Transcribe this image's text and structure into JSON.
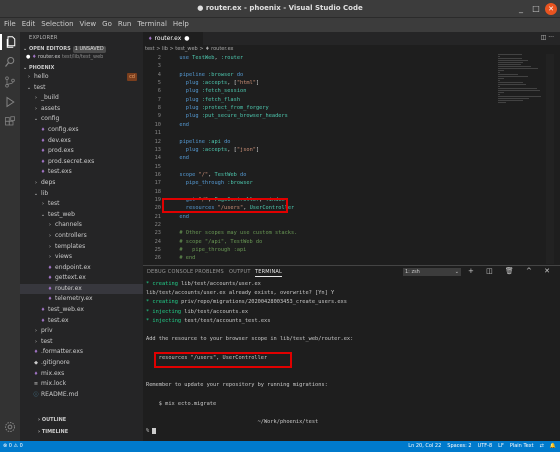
{
  "window": {
    "title": "● router.ex - phoenix - Visual Studio Code",
    "controls": {
      "minimize": "_",
      "maximize": "□",
      "close": "✕"
    }
  },
  "menu": [
    "File",
    "Edit",
    "Selection",
    "View",
    "Go",
    "Run",
    "Terminal",
    "Help"
  ],
  "sidebar": {
    "header": "EXPLORER",
    "open_editors": {
      "label": "OPEN EDITORS",
      "badge": "1 UNSAVED",
      "files": [
        {
          "dot": "●",
          "name": "router.ex",
          "path": "test/lib/test_web"
        }
      ]
    },
    "project": "PHOENIX",
    "tree": [
      {
        "indent": 0,
        "icon": "chevron-right",
        "label": "hello",
        "tag": "cd"
      },
      {
        "indent": 0,
        "icon": "chevron-down",
        "label": "test"
      },
      {
        "indent": 1,
        "icon": "chevron-right",
        "label": "_build"
      },
      {
        "indent": 1,
        "icon": "chevron-right",
        "label": "assets"
      },
      {
        "indent": 1,
        "icon": "chevron-down",
        "label": "config"
      },
      {
        "indent": 2,
        "icon": "elixir-file",
        "label": "config.exs"
      },
      {
        "indent": 2,
        "icon": "elixir-file",
        "label": "dev.exs"
      },
      {
        "indent": 2,
        "icon": "elixir-file",
        "label": "prod.exs"
      },
      {
        "indent": 2,
        "icon": "elixir-file",
        "label": "prod.secret.exs"
      },
      {
        "indent": 2,
        "icon": "elixir-file",
        "label": "test.exs"
      },
      {
        "indent": 1,
        "icon": "chevron-right",
        "label": "deps"
      },
      {
        "indent": 1,
        "icon": "chevron-down",
        "label": "lib"
      },
      {
        "indent": 2,
        "icon": "chevron-right",
        "label": "test"
      },
      {
        "indent": 2,
        "icon": "chevron-down",
        "label": "test_web"
      },
      {
        "indent": 3,
        "icon": "chevron-right",
        "label": "channels"
      },
      {
        "indent": 3,
        "icon": "chevron-right",
        "label": "controllers"
      },
      {
        "indent": 3,
        "icon": "chevron-right",
        "label": "templates"
      },
      {
        "indent": 3,
        "icon": "chevron-right",
        "label": "views"
      },
      {
        "indent": 3,
        "icon": "elixir-file",
        "label": "endpoint.ex"
      },
      {
        "indent": 3,
        "icon": "elixir-file",
        "label": "gettext.ex"
      },
      {
        "indent": 3,
        "icon": "elixir-file",
        "label": "router.ex",
        "selected": true
      },
      {
        "indent": 3,
        "icon": "elixir-file",
        "label": "telemetry.ex"
      },
      {
        "indent": 2,
        "icon": "elixir-file",
        "label": "test_web.ex"
      },
      {
        "indent": 2,
        "icon": "elixir-file",
        "label": "test.ex"
      },
      {
        "indent": 1,
        "icon": "chevron-right",
        "label": "priv"
      },
      {
        "indent": 1,
        "icon": "chevron-right",
        "label": "test"
      },
      {
        "indent": 1,
        "icon": "elixir-file",
        "label": ".formatter.exs"
      },
      {
        "indent": 1,
        "icon": "git-file",
        "label": ".gitignore"
      },
      {
        "indent": 1,
        "icon": "elixir-file",
        "label": "mix.exs"
      },
      {
        "indent": 1,
        "icon": "lock-file",
        "label": "mix.lock"
      },
      {
        "indent": 1,
        "icon": "info-file",
        "label": "README.md"
      }
    ],
    "outline": "OUTLINE",
    "timeline": "TIMELINE"
  },
  "editor": {
    "tab": {
      "label": "router.ex",
      "dirty": "●"
    },
    "tab_actions": "◫ ···",
    "breadcrumb": "test > lib > test_web > ♦ router.ex",
    "lines": [
      {
        "n": "2",
        "code": "  use TestWeb, :router"
      },
      {
        "n": "3",
        "code": ""
      },
      {
        "n": "4",
        "code": "  pipeline :browser do"
      },
      {
        "n": "5",
        "code": "    plug :accepts, [\"html\"]"
      },
      {
        "n": "6",
        "code": "    plug :fetch_session"
      },
      {
        "n": "7",
        "code": "    plug :fetch_flash"
      },
      {
        "n": "8",
        "code": "    plug :protect_from_forgery"
      },
      {
        "n": "9",
        "code": "    plug :put_secure_browser_headers"
      },
      {
        "n": "10",
        "code": "  end"
      },
      {
        "n": "11",
        "code": ""
      },
      {
        "n": "12",
        "code": "  pipeline :api do"
      },
      {
        "n": "13",
        "code": "    plug :accepts, [\"json\"]"
      },
      {
        "n": "14",
        "code": "  end"
      },
      {
        "n": "15",
        "code": ""
      },
      {
        "n": "16",
        "code": "  scope \"/\", TestWeb do"
      },
      {
        "n": "17",
        "code": "    pipe_through :browser"
      },
      {
        "n": "18",
        "code": ""
      },
      {
        "n": "19",
        "code": "    get \"/\", PageController, :index"
      },
      {
        "n": "20",
        "code": "    resources \"/users\", UserController"
      },
      {
        "n": "21",
        "code": "  end"
      },
      {
        "n": "22",
        "code": ""
      },
      {
        "n": "23",
        "code": "  # Other scopes may use custom stacks."
      },
      {
        "n": "24",
        "code": "  # scope \"/api\", TestWeb do"
      },
      {
        "n": "25",
        "code": "  #   pipe_through :api"
      },
      {
        "n": "26",
        "code": "  # end"
      }
    ]
  },
  "panel": {
    "tabs": [
      "DEBUG CONSOLE",
      "PROBLEMS",
      "OUTPUT",
      "TERMINAL"
    ],
    "active_tab": "TERMINAL",
    "terminal_select": "1: zsh",
    "actions": "+ ◫ 🗑 ^ ✕",
    "lines": [
      {
        "g": "* creating ",
        "t": "lib/test/accounts/user.ex"
      },
      {
        "g": "",
        "t": "lib/test/accounts/user.ex already exists, overwrite? [Yn] Y"
      },
      {
        "g": "* creating ",
        "t": "priv/repo/migrations/20200428003453_create_users.exs"
      },
      {
        "g": "* injecting ",
        "t": "lib/test/accounts.ex"
      },
      {
        "g": "* injecting ",
        "t": "test/test/accounts_test.exs"
      },
      {
        "g": "",
        "t": ""
      },
      {
        "g": "",
        "t": "Add the resource to your browser scope in lib/test_web/router.ex:"
      },
      {
        "g": "",
        "t": ""
      },
      {
        "g": "",
        "t": "    resources \"/users\", UserController"
      },
      {
        "g": "",
        "t": ""
      },
      {
        "g": "",
        "t": ""
      },
      {
        "g": "",
        "t": "Remember to update your repository by running migrations:"
      },
      {
        "g": "",
        "t": ""
      },
      {
        "g": "",
        "t": "    $ mix ecto.migrate"
      },
      {
        "g": "",
        "t": ""
      },
      {
        "g": "",
        "t": "                                   ~/Work/phoenix/test"
      },
      {
        "g": "",
        "t": "% "
      }
    ]
  },
  "status": {
    "left": "⊗ 0 ⚠ 0",
    "items": [
      "Ln 20, Col 22",
      "Spaces: 2",
      "UTF-8",
      "LF",
      "Plain Text",
      "⇄",
      "🔔"
    ]
  },
  "colors": {
    "accent": "#007acc",
    "highlight_box": "#e00000",
    "close": "#e95420"
  }
}
